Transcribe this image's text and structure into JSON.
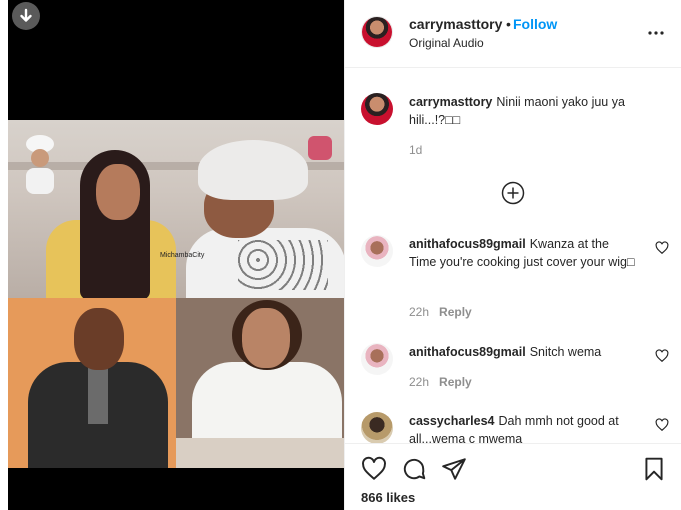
{
  "post": {
    "author": "carrymasttory",
    "follow_label": "Follow",
    "separator": "•",
    "audio": "Original Audio",
    "likes_text": "866 likes",
    "media_watermark": "MichambaCity"
  },
  "caption": {
    "username": "carrymasttory",
    "text": "Ninii maoni yako juu ya hili...!?□□",
    "time": "1d"
  },
  "comments": [
    {
      "username": "anithafocus89gmail",
      "text": "Kwanza at the Time you're cooking just cover your wig□",
      "time": "22h",
      "reply_label": "Reply"
    },
    {
      "username": "anithafocus89gmail",
      "text": "Snitch wema",
      "time": "22h",
      "reply_label": "Reply"
    },
    {
      "username": "cassycharles4",
      "text": "Dah mmh not good at all...wema c mwema",
      "time": "",
      "reply_label": ""
    }
  ],
  "icons": {
    "download": "download-arrow-icon",
    "more": "more-options-icon",
    "load_more": "plus-circle-icon",
    "like": "heart-icon",
    "comment": "comment-icon",
    "share": "share-icon",
    "save": "bookmark-icon"
  },
  "colors": {
    "accent": "#0095f6",
    "text": "#262626",
    "muted": "#8e8e8e",
    "border": "#efefef"
  }
}
